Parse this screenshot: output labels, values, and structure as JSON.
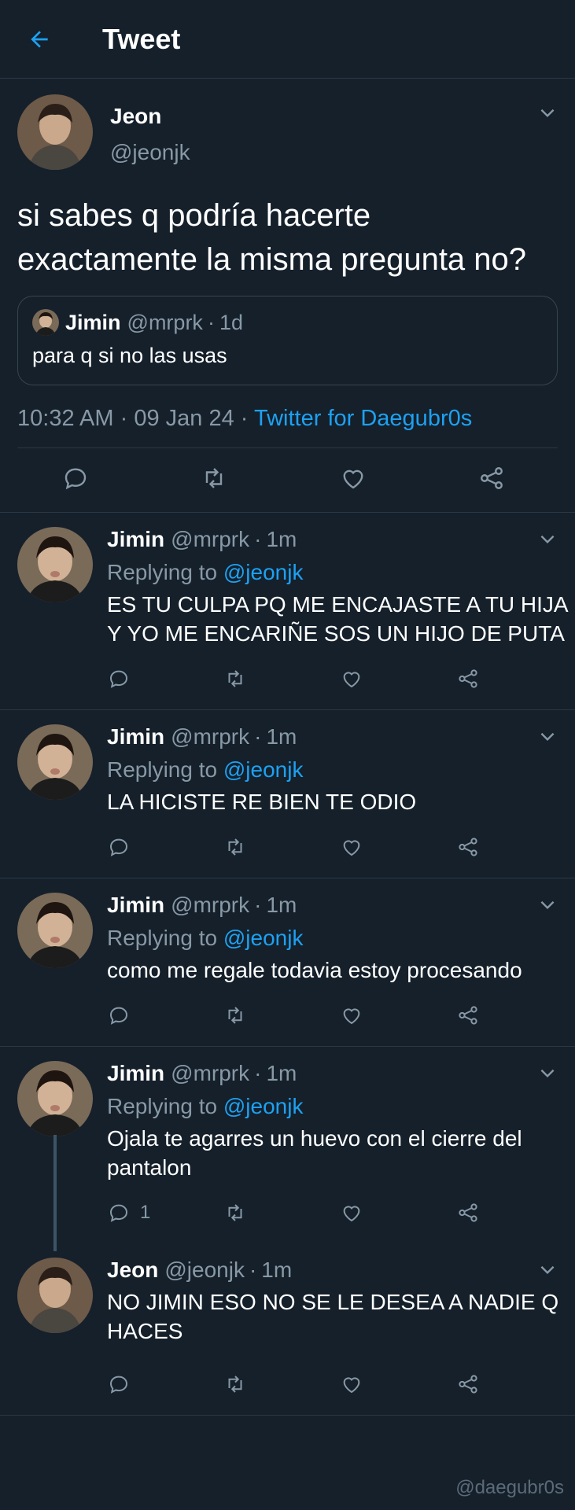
{
  "header": {
    "title": "Tweet",
    "back_icon": "arrow-left-icon"
  },
  "colors": {
    "background": "#15202b",
    "accent": "#1da1f2",
    "muted": "#8899a6",
    "divider": "#2a3744"
  },
  "main_tweet": {
    "name": "Jeon",
    "handle": "@jeonjk",
    "text": "si sabes q podría hacerte exactamente la misma pregunta no?",
    "quote": {
      "name": "Jimin",
      "handle": "@mrprk",
      "sep": "·",
      "time": "1d",
      "text": "para q si no las usas"
    },
    "time": "10:32 AM",
    "date": "09 Jan 24",
    "sep": "·",
    "source": "Twitter for Daegubr0s"
  },
  "replies": [
    {
      "name": "Jimin",
      "handle": "@mrprk",
      "sep": "·",
      "time": "1m",
      "replying_prefix": "Replying to",
      "mention": "@jeonjk",
      "text": "ES TU CULPA PQ ME ENCAJASTE A TU HIJA Y YO ME ENCARIÑE SOS UN HIJO DE PUTA",
      "reply_count": ""
    },
    {
      "name": "Jimin",
      "handle": "@mrprk",
      "sep": "·",
      "time": "1m",
      "replying_prefix": "Replying to",
      "mention": "@jeonjk",
      "text": "LA HICISTE RE BIEN TE ODIO",
      "reply_count": ""
    },
    {
      "name": "Jimin",
      "handle": "@mrprk",
      "sep": "·",
      "time": "1m",
      "replying_prefix": "Replying to",
      "mention": "@jeonjk",
      "text": "como me regale todavia estoy procesando",
      "reply_count": ""
    },
    {
      "name": "Jimin",
      "handle": "@mrprk",
      "sep": "·",
      "time": "1m",
      "replying_prefix": "Replying to",
      "mention": "@jeonjk",
      "text": "Ojala te agarres un huevo con el cierre del pantalon",
      "reply_count": "1"
    },
    {
      "name": "Jeon",
      "handle": "@jeonjk",
      "sep": "·",
      "time": "1m",
      "text": "NO JIMIN ESO NO SE LE DESEA A NADIE Q HACES",
      "reply_count": ""
    }
  ],
  "watermark": "@daegubr0s"
}
